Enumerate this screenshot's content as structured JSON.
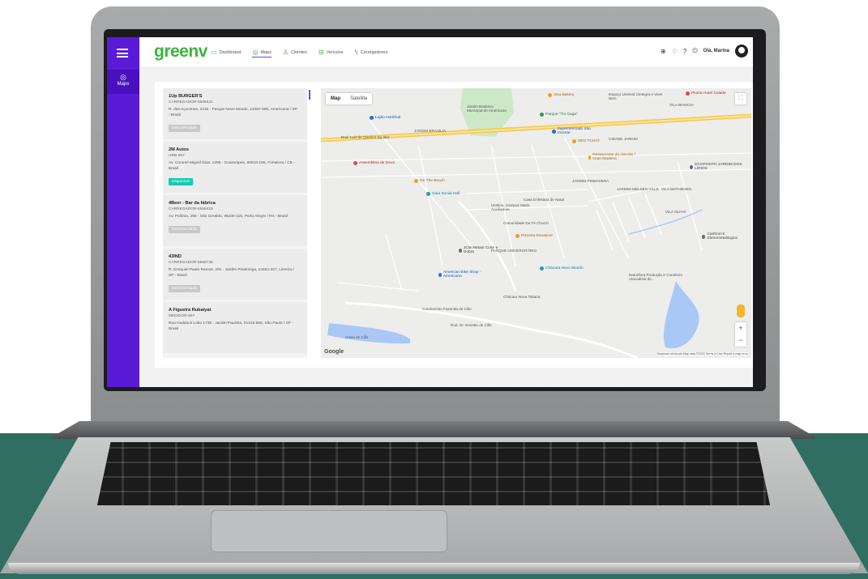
{
  "app": {
    "logo": "greenv",
    "greeting": "Olá, Marina"
  },
  "nav": [
    {
      "label": "Dashboard",
      "icon": "dashboard-icon"
    },
    {
      "label": "Maps",
      "icon": "map-pin-icon"
    },
    {
      "label": "Clientes",
      "icon": "user-icon"
    },
    {
      "label": "Veículos",
      "icon": "car-icon"
    },
    {
      "label": "Carregadores",
      "icon": "charger-icon"
    }
  ],
  "sidebar": {
    "maps_label": "Maps"
  },
  "stations": [
    {
      "name": "1Up BURGER'S",
      "code": "CARREGADOR-5556631",
      "address": "R. das Açucenas, 2132 - Parque Novo Mundo, 13467-595, Americana / SP - Brasil",
      "status": "Desconectado",
      "status_color": "#c8c8c8"
    },
    {
      "name": "2M Autos",
      "code": "URB-567",
      "address": "Av. Coronel Miguel Dias, 1295 - Guararapes, 60810-165, Fortaleza / CE - Brasil",
      "status": "Disponível",
      "status_color": "#14c8b4"
    },
    {
      "name": "4Beer - Bar da fábrica",
      "code": "CARREGADOR-5556415",
      "address": "Av. Polônia, 295 - São Geraldo, 95235-115, Porto Alegre / RS - Brasil",
      "status": "Desconectado",
      "status_color": "#c8c8c8"
    },
    {
      "name": "43IND",
      "code": "CARREGADOR-5556736",
      "address": "R. Ezequiel Paula Ramos, 291 - Jardim Piratininga, 13484-327, Limeira / SP - Brasil",
      "status": "Desconectado",
      "status_color": "#c8c8c8"
    },
    {
      "name": "A Figueira Rubaiyat",
      "code": "MEDIDOR-557",
      "address": "Rua Haddock Lobo 1738 - Jardim Paulista, 01415-565, São Paulo / SP - Brasil",
      "status": "",
      "status_color": "#c8c8c8"
    }
  ],
  "map": {
    "tab_map": "Map",
    "tab_satellite": "Satellite",
    "google": "Google",
    "attribution": "Keyboard shortcuts   Map data ©2023   Terms of Use   Report a map error",
    "zoom_in": "+",
    "zoom_out": "−",
    "labels": [
      "Rod. Luiz de Queiroz Sp 304",
      "JARDIM BRASÍLIA",
      "UNISAL Campus Maria Auxiliadora",
      "Comunidade Da Fé Church",
      "Casa Enfeitada de Natal",
      "Chácara Nova Tatiana",
      "Condomínio Fazenda de Cillo",
      "Usina de Cillo",
      "Rod. Dr. Ernesto de Cillo",
      "Jardim Botânico Municipal de Americana",
      "Espaço Unimed Cintegra e Viver Bem",
      "VILA BIANCHI",
      "CIDADE JARDIM",
      "JARDIM PRIMAVERA",
      "JARDIM NIELSEN VILLE",
      "VILA MATHIESEN",
      "VILA OLIVIA",
      "PARQUE UNIVERSITÁRIO",
      "Naturflora Produção e Comércio Atacadista de..."
    ],
    "pois": [
      {
        "label": "Assembleia de Deus",
        "color": "#e8453c"
      },
      {
        "label": "On The Beach",
        "color": "#f29b24"
      },
      {
        "label": "Gaia Social Hall",
        "color": "#1a9cc4"
      },
      {
        "label": "Pizzaria Renascer",
        "color": "#f29b24"
      },
      {
        "label": "Restaurante do Alemão / Gran Madeira",
        "color": "#f29b24"
      },
      {
        "label": "Parque \"Tio Gaga\"",
        "color": "#2c9a4e"
      },
      {
        "label": "Supermercado São Vicente",
        "color": "#1a73e8"
      },
      {
        "label": "SEO TCHAY",
        "color": "#f29b24"
      },
      {
        "label": "Carthom's Eletrometalúrgica",
        "color": "#5f6a7a"
      },
      {
        "label": "Chácara Novo Mundo",
        "color": "#1a9cc4"
      },
      {
        "label": "JCM Metais Corte e Dobra",
        "color": "#5f6a7a"
      },
      {
        "label": "American Bike Shop - Americana",
        "color": "#1a73e8"
      },
      {
        "label": "ECOPONTO JARDIM DOS LÍRIOS",
        "color": "#5f6a7a"
      },
      {
        "label": "Pluma Hotel Cidade",
        "color": "#e8453c"
      },
      {
        "label": "Lojão Hortifruti",
        "color": "#1a73e8"
      },
      {
        "label": "Viva Bakery",
        "color": "#f29b24"
      }
    ]
  }
}
